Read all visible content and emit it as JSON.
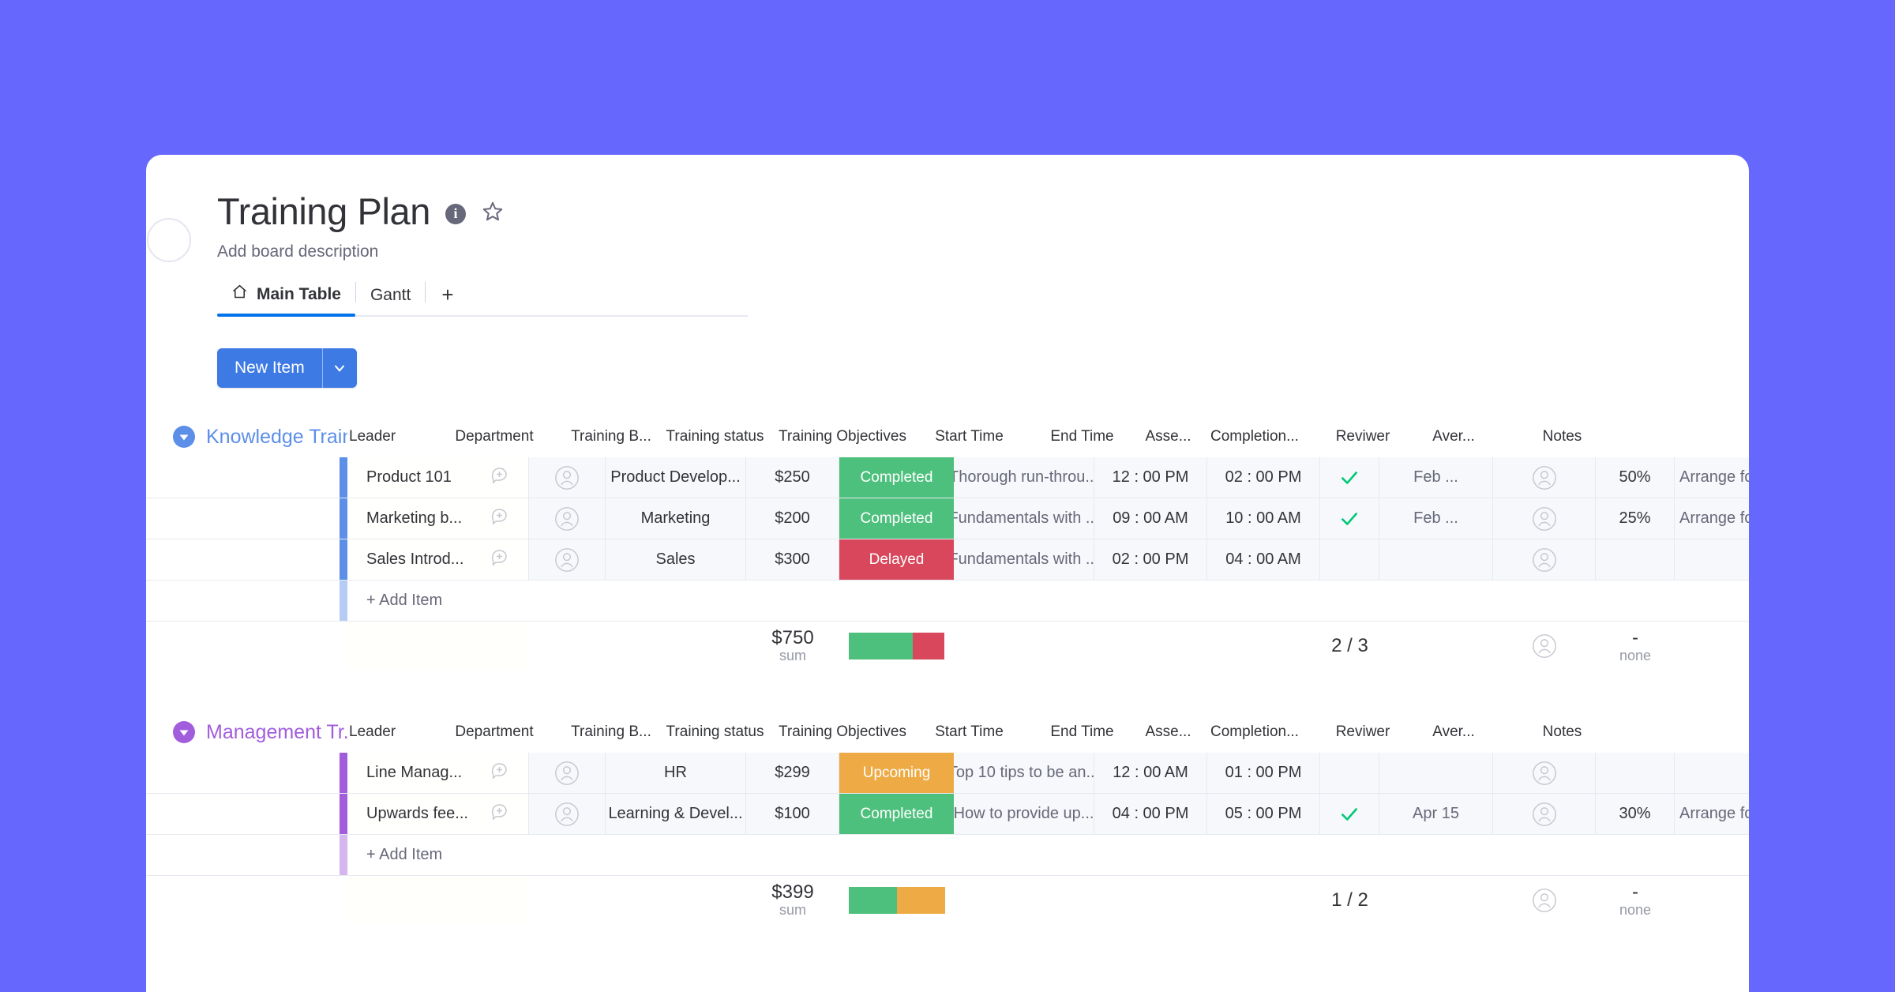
{
  "theme": {
    "background": "#6668fd",
    "accent_blue": "#0073ea",
    "button_blue": "#3d7ae4",
    "group_blue": "#5c8fe8",
    "group_purple": "#a25ddc",
    "status_green": "#4ec07d",
    "status_red": "#d9475c",
    "status_orange": "#eeab45",
    "check_green": "#00c875"
  },
  "header": {
    "title": "Training Plan",
    "info_icon": "info-icon",
    "star_icon": "star-icon",
    "back_icon": "back-circle",
    "description": "Add board description"
  },
  "tabs": [
    {
      "label": "Main Table",
      "icon": "home-icon",
      "active": true
    },
    {
      "label": "Gantt",
      "icon": "",
      "active": false
    }
  ],
  "tab_add_label": "+",
  "toolbar": {
    "new_item_label": "New Item",
    "new_item_dropdown_icon": "chevron-down-icon"
  },
  "columns": [
    "Leader",
    "Department",
    "Training B...",
    "Training status",
    "Training Objectives",
    "Start Time",
    "End Time",
    "Asse...",
    "Completion...",
    "Reviwer",
    "Aver...",
    "Notes"
  ],
  "add_item_label": "+ Add Item",
  "groups": [
    {
      "name": "Knowledge Train...",
      "color": "#5c8fe8",
      "caret_icon": "chevron-down-circle-icon",
      "items": [
        {
          "name": "Product 101",
          "leader": "",
          "department": "Product Develop...",
          "budget": "$250",
          "status": "Completed",
          "status_color": "#4ec07d",
          "objectives": "Thorough run-throu...",
          "start": "12 : 00 PM",
          "end": "02 : 00 PM",
          "assessment": "check",
          "completion": "Feb ...",
          "reviewer": "",
          "average": "50%",
          "notes": "Arrange follow up..."
        },
        {
          "name": "Marketing b...",
          "leader": "",
          "department": "Marketing",
          "budget": "$200",
          "status": "Completed",
          "status_color": "#4ec07d",
          "objectives": "Fundamentals with ...",
          "start": "09 : 00 AM",
          "end": "10 : 00 AM",
          "assessment": "check",
          "completion": "Feb ...",
          "reviewer": "",
          "average": "25%",
          "notes": "Arrange follow up..."
        },
        {
          "name": "Sales Introd...",
          "leader": "",
          "department": "Sales",
          "budget": "$300",
          "status": "Delayed",
          "status_color": "#d9475c",
          "objectives": "Fundamentals with ...",
          "start": "02 : 00 PM",
          "end": "04 : 00 AM",
          "assessment": "",
          "completion": "",
          "reviewer": "",
          "average": "",
          "notes": ""
        }
      ],
      "summary": {
        "budget_value": "$750",
        "budget_label": "sum",
        "battery": [
          {
            "color": "#4ec07d",
            "percent": 67
          },
          {
            "color": "#d9475c",
            "percent": 33
          }
        ],
        "assessment_value": "2 / 3",
        "average_value": "-",
        "average_label": "none"
      }
    },
    {
      "name": "Management Tr...",
      "color": "#a25ddc",
      "caret_icon": "chevron-down-circle-icon",
      "items": [
        {
          "name": "Line Manag...",
          "leader": "",
          "department": "HR",
          "budget": "$299",
          "status": "Upcoming",
          "status_color": "#eeab45",
          "objectives": "Top 10 tips to be an...",
          "start": "12 : 00 AM",
          "end": "01 : 00 PM",
          "assessment": "",
          "completion": "",
          "reviewer": "",
          "average": "",
          "notes": ""
        },
        {
          "name": "Upwards fee...",
          "leader": "",
          "department": "Learning & Devel...",
          "budget": "$100",
          "status": "Completed",
          "status_color": "#4ec07d",
          "objectives": "How to provide up...",
          "start": "04 : 00 PM",
          "end": "05 : 00 PM",
          "assessment": "check",
          "completion": "Apr 15",
          "reviewer": "",
          "average": "30%",
          "notes": "Arrange follow up..."
        }
      ],
      "summary": {
        "budget_value": "$399",
        "budget_label": "sum",
        "battery": [
          {
            "color": "#4ec07d",
            "percent": 50
          },
          {
            "color": "#eeab45",
            "percent": 50
          }
        ],
        "assessment_value": "1 / 2",
        "average_value": "-",
        "average_label": "none"
      }
    }
  ]
}
